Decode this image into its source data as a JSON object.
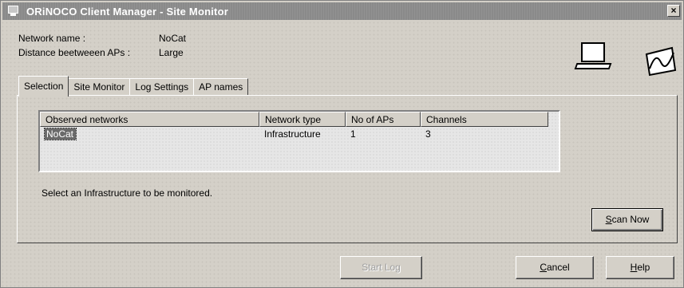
{
  "window": {
    "title": "ORiNOCO Client Manager - Site Monitor",
    "close_glyph": "×"
  },
  "info": {
    "network_name_label": "Network name :",
    "network_name_value": "NoCat",
    "distance_label": "Distance beetweeen APs :",
    "distance_value": "Large"
  },
  "icons": [
    "laptop-icon",
    "signal-wave-icon"
  ],
  "tabs": [
    {
      "label": "Selection",
      "active": true
    },
    {
      "label": "Site Monitor",
      "active": false
    },
    {
      "label": "Log Settings",
      "active": false
    },
    {
      "label": "AP names",
      "active": false
    }
  ],
  "networks_table": {
    "columns": [
      "Observed networks",
      "Network type",
      "No of APs",
      "Channels"
    ],
    "rows": [
      {
        "name": "NoCat",
        "type": "Infrastructure",
        "aps": "1",
        "channels": "3",
        "selected": true
      }
    ]
  },
  "hint": "Select an Infrastructure to be monitored.",
  "buttons": {
    "scan_now_prefix": "",
    "scan_now_accel": "S",
    "scan_now_rest": "can Now",
    "start_log": "Start Log",
    "cancel_accel": "C",
    "cancel_rest": "ancel",
    "help_accel": "H",
    "help_rest": "elp"
  }
}
